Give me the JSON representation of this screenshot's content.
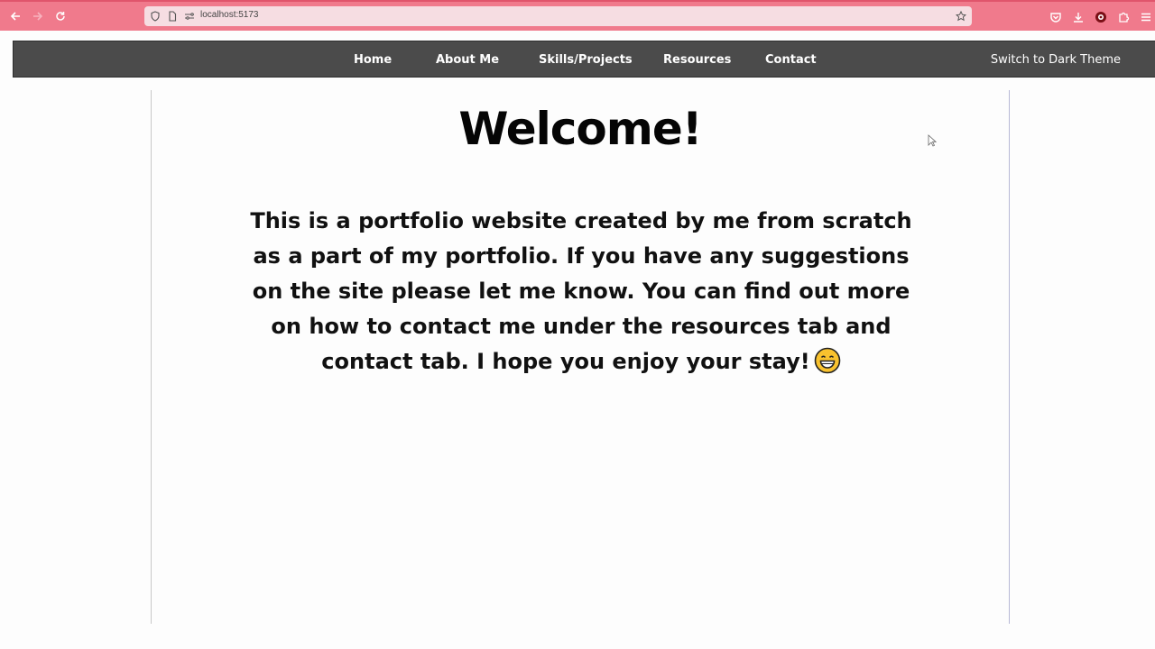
{
  "browser": {
    "url": "localhost:5173",
    "icons": {
      "back": "arrow-left-icon",
      "forward": "arrow-right-icon",
      "reload": "reload-icon",
      "shield": "shield-icon",
      "page": "page-icon",
      "permissions": "permissions-icon",
      "bookmark": "star-icon",
      "pocket": "pocket-icon",
      "downloads": "download-icon",
      "extension": "extension-icon",
      "addons": "puzzle-icon",
      "menu": "hamburger-icon"
    },
    "colors": {
      "toolbar": "#f07a8c",
      "urlbar": "#f6dde2"
    }
  },
  "nav": {
    "links": [
      "Home",
      "About Me",
      "Skills/Projects",
      "Resources",
      "Contact"
    ],
    "theme_toggle": "Switch to Dark Theme",
    "colors": {
      "background": "#4b4b4b",
      "text": "#ffffff"
    }
  },
  "main": {
    "title": "Welcome!",
    "intro": "This is a portfolio website created by me from scratch as a part of my portfolio. If you have any suggestions on the site please let me know. You can find out more on how to contact me under the resources tab and contact tab. I hope you enjoy your stay!",
    "emoji_icon": "grinning-face-icon"
  }
}
